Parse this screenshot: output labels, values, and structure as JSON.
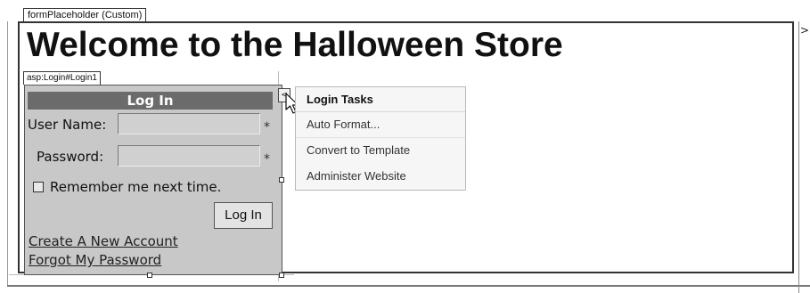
{
  "form_placeholder": {
    "tag": "formPlaceholder (Custom)"
  },
  "page": {
    "title": "Welcome to the Halloween Store"
  },
  "scroll": {
    "arrow": ">"
  },
  "login_control": {
    "tag": "asp:Login#Login1",
    "header": "Log In",
    "username_label": "User Name:",
    "username_value": "",
    "password_label": "Password:",
    "password_value": "",
    "required_marker": "*",
    "remember_label": "Remember me next time.",
    "remember_checked": false,
    "login_button": "Log In",
    "create_account_link": "Create A New Account",
    "forgot_password_link": "Forgot My Password"
  },
  "smart_tag": {
    "glyph": "<"
  },
  "tasks_panel": {
    "title": "Login Tasks",
    "items": [
      "Auto Format...",
      "Convert to Template",
      "Administer Website"
    ]
  },
  "colors": {
    "login_background": "#c8c8c8",
    "login_header": "#6b6b6b",
    "tasks_background": "#f6f6f6"
  }
}
